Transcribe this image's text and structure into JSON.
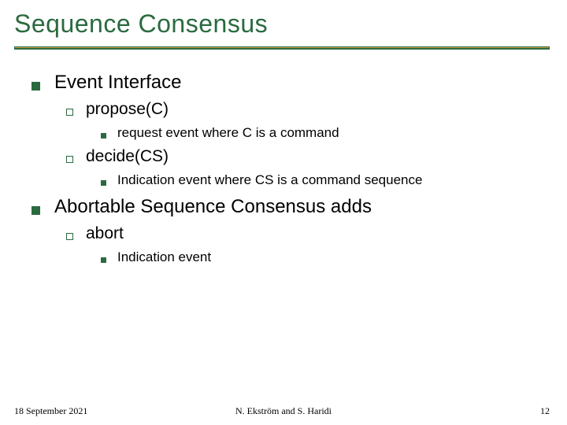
{
  "title": "Sequence Consensus",
  "items": [
    {
      "text": "Event Interface",
      "children": [
        {
          "text": "propose(C)",
          "children": [
            {
              "text": "request event where C is a command"
            }
          ]
        },
        {
          "text": "decide(CS)",
          "children": [
            {
              "text": "Indication event where CS is a command sequence"
            }
          ]
        }
      ]
    },
    {
      "text": "Abortable Sequence Consensus adds",
      "children": [
        {
          "text": "abort",
          "children": [
            {
              "text": "Indication event"
            }
          ]
        }
      ]
    }
  ],
  "footer": {
    "date": "18 September 2021",
    "authors": "N. Ekström and S. Haridi",
    "page": "12"
  }
}
